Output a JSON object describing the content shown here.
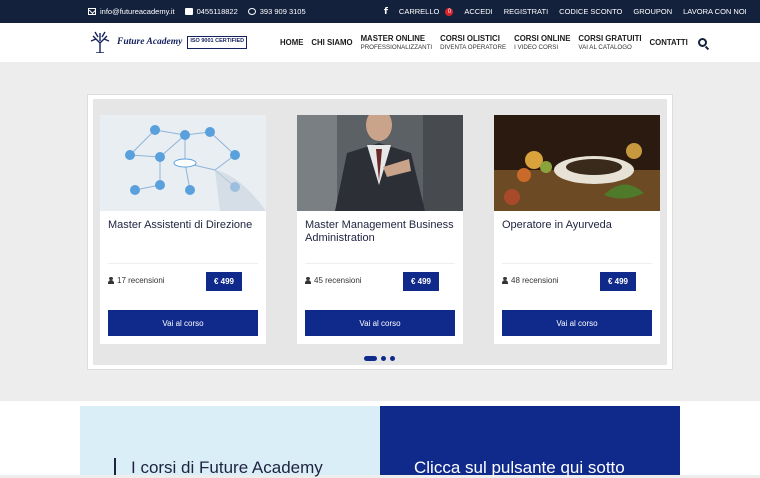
{
  "topbar": {
    "email": "info@futureacademy.it",
    "phone": "0455118822",
    "whatsapp": "393 909 3105",
    "cart_label": "CARRELLO",
    "cart_count": "0",
    "links": [
      "ACCEDI",
      "REGISTRATI",
      "CODICE SCONTO",
      "GROUPON",
      "LAVORA CON NOI"
    ]
  },
  "logo": {
    "name": "Future Academy",
    "iso_label": "ISO 9001 CERTIFIED"
  },
  "nav": [
    {
      "label": "HOME",
      "sub": ""
    },
    {
      "label": "CHI SIAMO",
      "sub": ""
    },
    {
      "label": "MASTER ONLINE",
      "sub": "PROFESSIONALIZZANTI"
    },
    {
      "label": "CORSI OLISTICI",
      "sub": "DIVENTA OPERATORE"
    },
    {
      "label": "CORSI ONLINE",
      "sub": "I VIDEO CORSI"
    },
    {
      "label": "CORSI GRATUITI",
      "sub": "VAI AL CATALOGO"
    },
    {
      "label": "CONTATTI",
      "sub": ""
    }
  ],
  "cards": [
    {
      "title": "Master Assistenti di Direzione",
      "reviews": "17 recensioni",
      "price": "€ 499",
      "cta": "Vai al corso"
    },
    {
      "title": "Master Management Business Administration",
      "reviews": "45 recensioni",
      "price": "€ 499",
      "cta": "Vai al corso"
    },
    {
      "title": "Operatore in Ayurveda",
      "reviews": "48 recensioni",
      "price": "€ 499",
      "cta": "Vai al corso"
    }
  ],
  "bottom": {
    "left_text": "I corsi di Future Academy",
    "right_text": "Clicca sul pulsante qui sotto"
  },
  "colors": {
    "topbar": "#14213d",
    "primary": "#102a8c",
    "badge": "#d8232a"
  }
}
